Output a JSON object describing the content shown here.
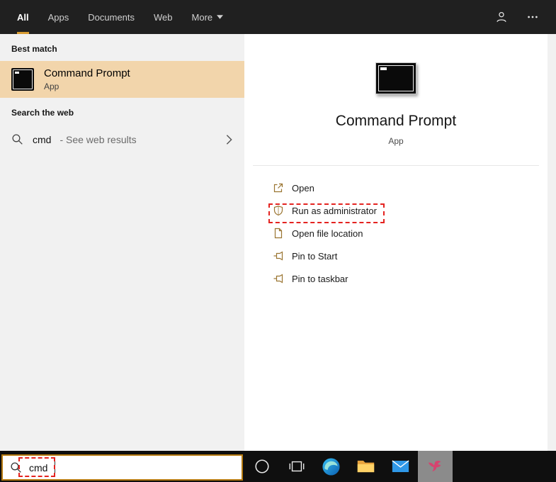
{
  "header": {
    "tabs": [
      {
        "label": "All",
        "active": true
      },
      {
        "label": "Apps",
        "active": false
      },
      {
        "label": "Documents",
        "active": false
      },
      {
        "label": "Web",
        "active": false
      },
      {
        "label": "More",
        "active": false,
        "has_dropdown": true
      }
    ],
    "right_icons": [
      "user-icon",
      "more-options-icon"
    ]
  },
  "left_panel": {
    "best_match_header": "Best match",
    "best_match": {
      "title": "Command Prompt",
      "subtitle": "App",
      "icon": "command-prompt-icon"
    },
    "search_web_header": "Search the web",
    "web_item": {
      "query": "cmd",
      "suffix": " - See web results",
      "icon": "search-icon",
      "chevron": "chevron-right-icon"
    }
  },
  "right_panel": {
    "app_icon": "command-prompt-icon",
    "title": "Command Prompt",
    "subtitle": "App",
    "actions": [
      {
        "label": "Open",
        "icon": "open-icon"
      },
      {
        "label": "Run as administrator",
        "icon": "shield-icon",
        "annotated": true
      },
      {
        "label": "Open file location",
        "icon": "file-location-icon"
      },
      {
        "label": "Pin to Start",
        "icon": "pin-icon"
      },
      {
        "label": "Pin to taskbar",
        "icon": "pin-icon"
      }
    ]
  },
  "search_box": {
    "value": "cmd",
    "icon": "search-icon",
    "annotated": true
  },
  "taskbar": {
    "icons": [
      "cortana-icon",
      "task-view-icon",
      "edge-icon",
      "file-explorer-icon",
      "mail-icon",
      "hummingbird-app-icon"
    ],
    "active_icon": "hummingbird-app-icon"
  },
  "annotations": [
    {
      "target": "run-as-administrator-action"
    },
    {
      "target": "search-input-text"
    }
  ],
  "colors": {
    "accent": "#d79b32",
    "search_border": "#b5790f",
    "highlight": "#f2d5ab",
    "annotation": "#e42320",
    "action_icon": "#9a7430"
  }
}
